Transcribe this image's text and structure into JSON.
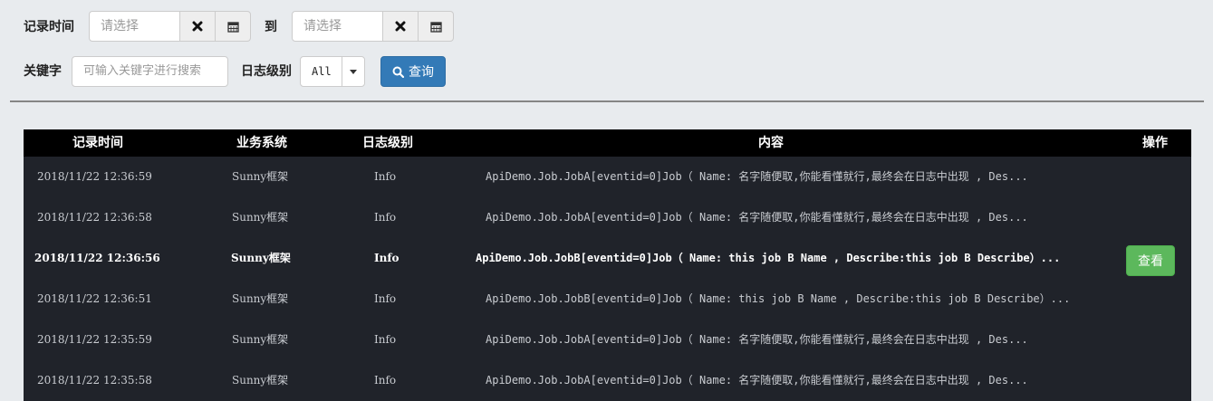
{
  "filters": {
    "time_label": "记录时间",
    "start_placeholder": "请选择",
    "to_label": "到",
    "end_placeholder": "请选择",
    "keyword_label": "关键字",
    "keyword_placeholder": "可输入关键字进行搜索",
    "level_label": "日志级别",
    "level_value": "All",
    "search_label": "查询"
  },
  "table": {
    "headers": [
      "记录时间",
      "业务系统",
      "日志级别",
      "内容",
      "操作"
    ],
    "rows": [
      {
        "time": "2018/11/22 12:36:59",
        "system": "Sunny框架",
        "level": "Info",
        "content": "ApiDemo.Job.JobA[eventid=0]Job（ Name: 名字随便取,你能看懂就行,最终会在日志中出现 , Des...",
        "action": ""
      },
      {
        "time": "2018/11/22 12:36:58",
        "system": "Sunny框架",
        "level": "Info",
        "content": "ApiDemo.Job.JobA[eventid=0]Job（ Name: 名字随便取,你能看懂就行,最终会在日志中出现 , Des...",
        "action": ""
      },
      {
        "time": "2018/11/22 12:36:56",
        "system": "Sunny框架",
        "level": "Info",
        "content": "ApiDemo.Job.JobB[eventid=0]Job（ Name: this job B Name , Describe:this job B Describe）...",
        "action": "查看"
      },
      {
        "time": "2018/11/22 12:36:51",
        "system": "Sunny框架",
        "level": "Info",
        "content": "ApiDemo.Job.JobB[eventid=0]Job（ Name: this job B Name , Describe:this job B Describe）...",
        "action": ""
      },
      {
        "time": "2018/11/22 12:35:59",
        "system": "Sunny框架",
        "level": "Info",
        "content": "ApiDemo.Job.JobA[eventid=0]Job（ Name: 名字随便取,你能看懂就行,最终会在日志中出现 , Des...",
        "action": ""
      },
      {
        "time": "2018/11/22 12:35:58",
        "system": "Sunny框架",
        "level": "Info",
        "content": "ApiDemo.Job.JobA[eventid=0]Job（ Name: 名字随便取,你能看懂就行,最终会在日志中出现 , Des...",
        "action": ""
      }
    ],
    "highlighted_row": 2
  },
  "icons": {
    "clear": "close-icon",
    "calendar": "calendar-icon",
    "search": "search-icon",
    "dropdown": "caret-down-icon"
  },
  "colors": {
    "primary": "#337ab7",
    "success": "#5cb85c",
    "table_header": "#000000",
    "table_body": "#20232a"
  }
}
